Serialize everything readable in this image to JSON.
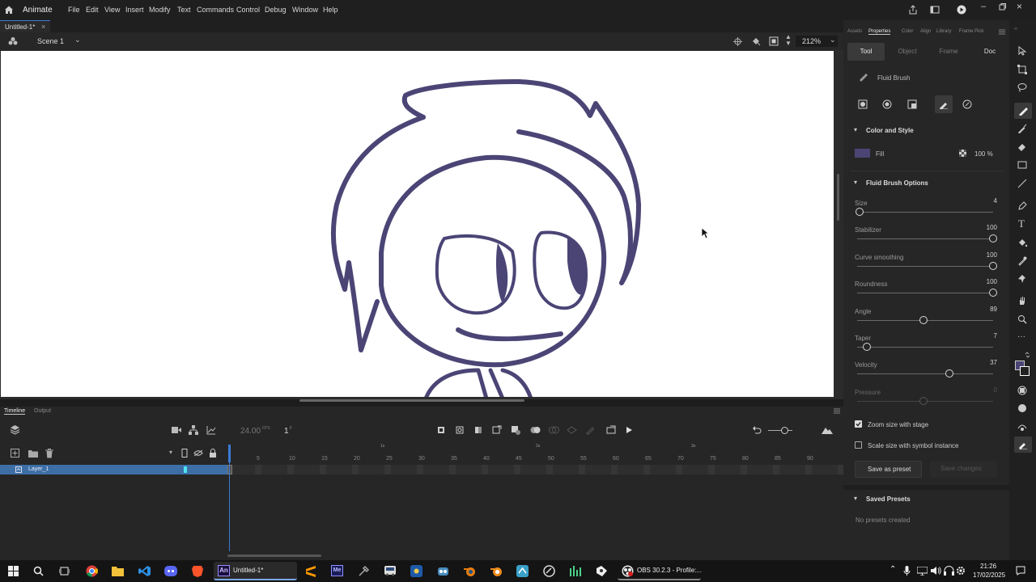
{
  "app": {
    "name": "Animate",
    "menus": [
      "File",
      "Edit",
      "View",
      "Insert",
      "Modify",
      "Text",
      "Commands",
      "Control",
      "Debug",
      "Window",
      "Help"
    ]
  },
  "doc": {
    "tab": "Untitled-1*",
    "tab_close": "×",
    "scene": "Scene 1",
    "zoom": "212%"
  },
  "panel_tabs": [
    "Assets",
    "Properties",
    "Color",
    "Align",
    "Library",
    "Frame Pick"
  ],
  "prop_tabs": [
    "Tool",
    "Object",
    "Frame",
    "Doc"
  ],
  "tool_name": "Fluid Brush",
  "color_style": {
    "heading": "Color and Style",
    "fill_label": "Fill",
    "fill_color": "#4a4575",
    "opacity": "100 %"
  },
  "brush_options": {
    "heading": "Fluid Brush Options",
    "sliders": [
      {
        "label": "Size",
        "value": "4",
        "fraction": 0.02
      },
      {
        "label": "Stabilizer",
        "value": "100",
        "fraction": 1.0
      },
      {
        "label": "Curve smoothing",
        "value": "100",
        "fraction": 1.0
      },
      {
        "label": "Roundness",
        "value": "100",
        "fraction": 1.0
      },
      {
        "label": "Angle",
        "value": "89",
        "fraction": 0.49
      },
      {
        "label": "Taper",
        "value": "7",
        "fraction": 0.07
      },
      {
        "label": "Velocity",
        "value": "37",
        "fraction": 0.68
      },
      {
        "label": "Pressure",
        "value": "0",
        "fraction": 0.49
      }
    ],
    "zoom_size": "Zoom size with stage",
    "scale_size": "Scale size with symbol instance",
    "save_preset": "Save as preset",
    "save_changes": "Save changes"
  },
  "saved_presets": {
    "heading": "Saved Presets",
    "empty": "No presets created"
  },
  "timeline": {
    "tab": "Timeline",
    "tab2": "Output",
    "fps": "24.00",
    "fps_unit": "FPS",
    "frame": "1",
    "frame_unit": "F",
    "layer": "Layer_1",
    "ruler": [
      "5",
      "10",
      "15",
      "20",
      "25",
      "30",
      "35",
      "40",
      "45",
      "50",
      "55",
      "60",
      "65",
      "70",
      "75",
      "80",
      "85",
      "90"
    ],
    "seconds": [
      "1s",
      "2s",
      "3s"
    ]
  },
  "taskbar": {
    "app_label": "Untitled-1*",
    "obs_label": "OBS 30.2.3 - Profile:...",
    "time": "21:26",
    "date": "17/02/2025"
  },
  "colors": {
    "accent": "#3a7bd5",
    "stroke": "#4a4575",
    "layer_sel": "#3d6fa6"
  }
}
